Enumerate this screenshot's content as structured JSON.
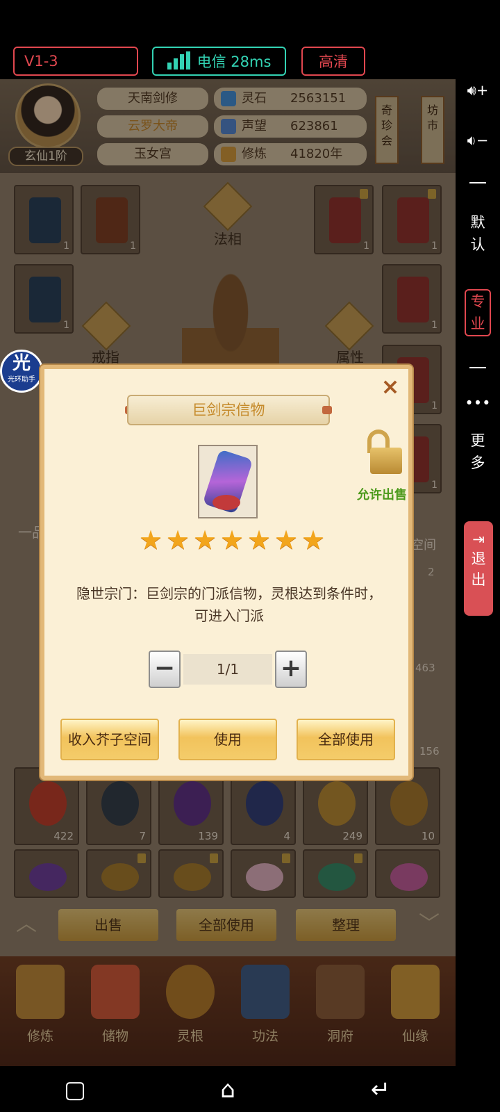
{
  "stream_bar": {
    "version": "V1-3",
    "network": "电信 28ms",
    "quality": "高清",
    "colors": {
      "alert": "#e1474f",
      "network": "#33d3b4"
    }
  },
  "side_panel": {
    "volume_up_icon": "volume-up-icon",
    "volume_down_icon": "volume-down-icon",
    "default_label_1": "默",
    "default_label_2": "认",
    "pro_label_1": "专",
    "pro_label_2": "业",
    "more_label_1": "更",
    "more_label_2": "多",
    "exit_label_1": "退",
    "exit_label_2": "出"
  },
  "player": {
    "rank": "玄仙1阶",
    "name_rows": [
      "天南剑修",
      "云罗大帝",
      "玉女宫"
    ],
    "stats": [
      {
        "label": "灵石",
        "value": "2563151"
      },
      {
        "label": "声望",
        "value": "623861"
      },
      {
        "label": "修炼",
        "value": "41820年"
      }
    ],
    "banners": [
      "奇珍会",
      "坊市"
    ]
  },
  "equipment": {
    "labels": {
      "fa_xiang": "法相",
      "ring": "戒指",
      "attribute": "属性",
      "grade": "一品",
      "storage": "芥子空间"
    },
    "left_slots": [
      "1",
      "1",
      "1"
    ],
    "right_slots": [
      "1",
      "1",
      "1",
      "1",
      "1"
    ]
  },
  "inventory_rows": [
    [
      "422",
      "7",
      "139",
      "4",
      "249",
      "10"
    ]
  ],
  "side_counts": [
    "2",
    "463",
    "156"
  ],
  "bottom_actions": {
    "sell": "出售",
    "use_all": "全部使用",
    "sort": "整理"
  },
  "bottom_nav": [
    "修炼",
    "储物",
    "灵根",
    "功法",
    "洞府",
    "仙缘"
  ],
  "float_helper": {
    "big": "光",
    "small": "光环助手"
  },
  "dialog": {
    "title": "巨剑宗信物",
    "allow_sell": "允许出售",
    "stars": 7,
    "star_glyph": "★",
    "description_line1": "隐世宗门：巨剑宗的门派信物，灵根达到条件时，",
    "description_line2": "可进入门派",
    "quantity": "1/1",
    "minus": "−",
    "plus": "+",
    "close": "×",
    "buttons": {
      "store": "收入芥子空间",
      "use": "使用",
      "use_all": "全部使用"
    }
  },
  "android_nav": {
    "recent": "▢",
    "home": "⌂",
    "back": "↵"
  }
}
